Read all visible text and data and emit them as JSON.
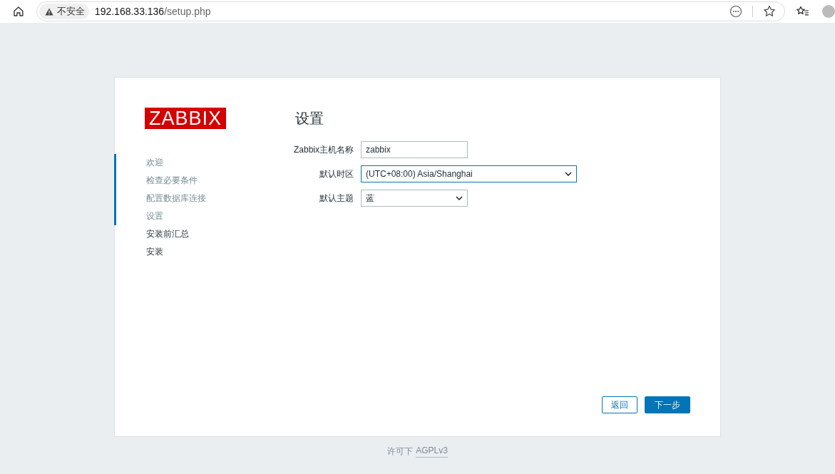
{
  "browser": {
    "security_label": "不安全",
    "url_host": "192.168.33.136",
    "url_path": "/setup.php"
  },
  "logo": "ZABBIX",
  "steps": [
    {
      "label": "欢迎",
      "done": true
    },
    {
      "label": "检查必要条件",
      "done": true
    },
    {
      "label": "配置数据库连接",
      "done": true
    },
    {
      "label": "设置",
      "done": true
    },
    {
      "label": "安装前汇总",
      "done": false
    },
    {
      "label": "安装",
      "done": false
    }
  ],
  "title": "设置",
  "form": [
    {
      "kind": "text",
      "label": "Zabbix主机名称",
      "value": "zabbix",
      "focused": false,
      "wide": false
    },
    {
      "kind": "select",
      "label": "默认时区",
      "value": "(UTC+08:00) Asia/Shanghai",
      "focused": true,
      "wide": true
    },
    {
      "kind": "select",
      "label": "默认主题",
      "value": "蓝",
      "focused": false,
      "wide": false
    }
  ],
  "buttons": [
    {
      "label": "返回",
      "kind": "secondary"
    },
    {
      "label": "下一步",
      "kind": "primary"
    }
  ],
  "footer": {
    "text": "许可下",
    "link": "AGPLv3"
  }
}
